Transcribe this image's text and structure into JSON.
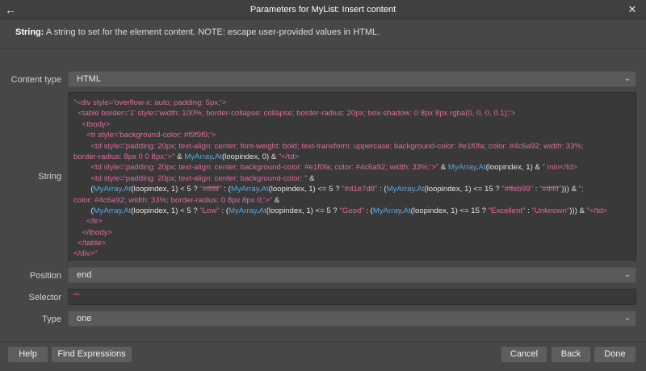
{
  "window": {
    "title": "Parameters for MyList: Insert content",
    "back_icon": "arrow-left-icon",
    "close_icon": "close-icon"
  },
  "description": {
    "bold": "String:",
    "text": " A string to set for the element content. NOTE: escape user-provided values in HTML."
  },
  "fields": {
    "content_type": {
      "label": "Content type",
      "value": "HTML"
    },
    "string": {
      "label": "String",
      "lines": [
        [
          [
            "s",
            "\"<div style='overflow-x: auto; padding: 5px;'>"
          ]
        ],
        [
          [
            "s",
            "  <table border='1' style='width: 100%; border-collapse: collapse; border-radius: 20px; box-shadow: 0 8px 8px rgba(0, 0, 0, 0.1);'>"
          ]
        ],
        [
          [
            "s",
            "    <tbody>"
          ]
        ],
        [
          [
            "s",
            "      <tr style='background-color: #f9f9f9;'>"
          ]
        ],
        [
          [
            "s",
            "        <td style='padding: 20px; text-align: center; font-weight: bold; text-transform: uppercase; background-color: #e1f0fa; color: #4c6a92; width: 33%;"
          ]
        ],
        [
          [
            "s",
            "border-radius: 8px 0 0 8px;'>\""
          ],
          [
            "o",
            " & "
          ],
          [
            "f",
            "MyArray"
          ],
          [
            "o",
            "."
          ],
          [
            "f",
            "At"
          ],
          [
            "o",
            "(loopindex, "
          ],
          [
            "n",
            "0"
          ],
          [
            "o",
            ") & "
          ],
          [
            "s",
            "\"</td>"
          ]
        ],
        [
          [
            "s",
            "        <td style='padding: 20px; text-align: center; background-color: #e1f0fa; color: #4c6a92; width: 33%;'>\""
          ],
          [
            "o",
            " & "
          ],
          [
            "f",
            "MyArray"
          ],
          [
            "o",
            "."
          ],
          [
            "f",
            "At"
          ],
          [
            "o",
            "(loopindex, "
          ],
          [
            "n",
            "1"
          ],
          [
            "o",
            ") & "
          ],
          [
            "s",
            "\" min</td>"
          ]
        ],
        [
          [
            "s",
            "        <td style='padding: 20px; text-align: center; background-color: \""
          ],
          [
            "o",
            " &"
          ]
        ],
        [
          [
            "o",
            "        ("
          ],
          [
            "f",
            "MyArray"
          ],
          [
            "o",
            "."
          ],
          [
            "f",
            "At"
          ],
          [
            "o",
            "(loopindex, 1) < 5 ? "
          ],
          [
            "s",
            "\"#ffffff\""
          ],
          [
            "o",
            " : ("
          ],
          [
            "f",
            "MyArray"
          ],
          [
            "o",
            "."
          ],
          [
            "f",
            "At"
          ],
          [
            "o",
            "(loopindex, 1) <= 5 ? "
          ],
          [
            "s",
            "\"#d1e7d8\""
          ],
          [
            "o",
            " : ("
          ],
          [
            "f",
            "MyArray"
          ],
          [
            "o",
            "."
          ],
          [
            "f",
            "At"
          ],
          [
            "o",
            "(loopindex, 1) <= 15 ? "
          ],
          [
            "s",
            "\"#ffeb99\""
          ],
          [
            "o",
            " : "
          ],
          [
            "s",
            "\"#ffffff\""
          ],
          [
            "o",
            "))) & "
          ],
          [
            "s",
            "\";"
          ]
        ],
        [
          [
            "s",
            "color: #4c6a92; width: 33%; border-radius: 0 8px 8px 0;'>\""
          ],
          [
            "o",
            " &"
          ]
        ],
        [
          [
            "o",
            "        ("
          ],
          [
            "f",
            "MyArray"
          ],
          [
            "o",
            "."
          ],
          [
            "f",
            "At"
          ],
          [
            "o",
            "(loopindex, 1) < 5 ? "
          ],
          [
            "s",
            "\"Low\""
          ],
          [
            "o",
            " : ("
          ],
          [
            "f",
            "MyArray"
          ],
          [
            "o",
            "."
          ],
          [
            "f",
            "At"
          ],
          [
            "o",
            "(loopindex, 1) <= 5 ? "
          ],
          [
            "s",
            "\"Good\""
          ],
          [
            "o",
            " : ("
          ],
          [
            "f",
            "MyArray"
          ],
          [
            "o",
            "."
          ],
          [
            "f",
            "At"
          ],
          [
            "o",
            "(loopindex, 1) <= 15 ? "
          ],
          [
            "s",
            "\"Excellent\""
          ],
          [
            "o",
            " : "
          ],
          [
            "s",
            "\"Unknown\""
          ],
          [
            "o",
            "))) & "
          ],
          [
            "s",
            "\"</td>"
          ]
        ],
        [
          [
            "s",
            "      </tr>"
          ]
        ],
        [
          [
            "s",
            "    </tbody>"
          ]
        ],
        [
          [
            "s",
            "  </table>"
          ]
        ],
        [
          [
            "s",
            "</div>\""
          ]
        ]
      ]
    },
    "position": {
      "label": "Position",
      "value": "end"
    },
    "selector": {
      "label": "Selector",
      "value": "\"\""
    },
    "type": {
      "label": "Type",
      "value": "one"
    }
  },
  "buttons": {
    "help": "Help",
    "find_expressions": "Find Expressions",
    "cancel": "Cancel",
    "back": "Back",
    "done": "Done"
  },
  "colors": {
    "string_literal": "#e06ba0",
    "function": "#5ba6e0",
    "operator": "#e2e2e2",
    "selector_value": "#e05a78"
  }
}
